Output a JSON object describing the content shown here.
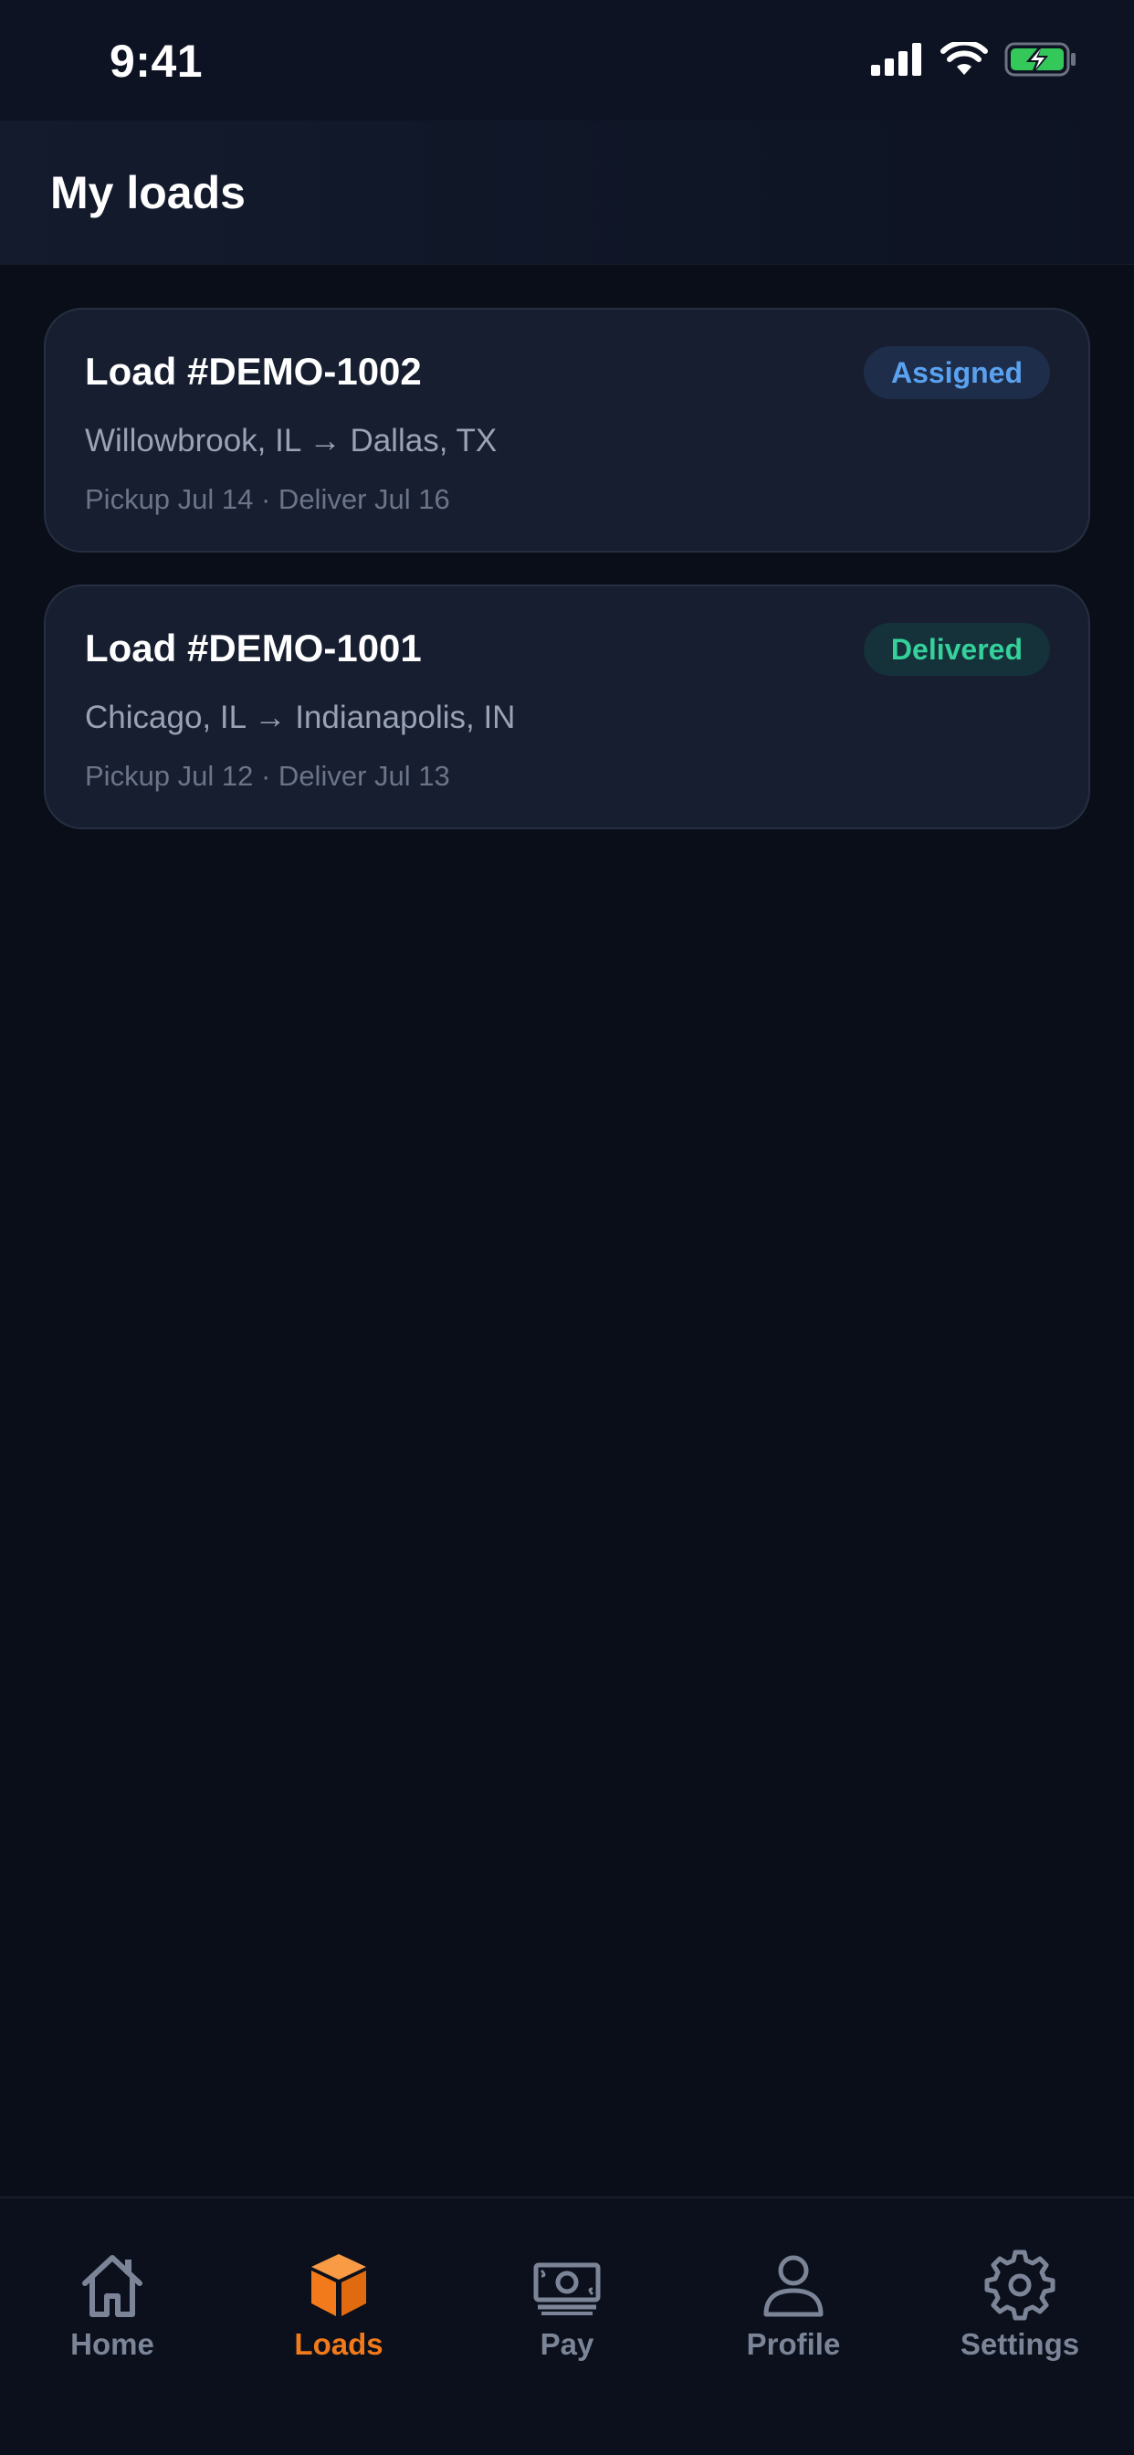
{
  "status_bar": {
    "time": "9:41"
  },
  "header": {
    "title": "My loads"
  },
  "loads": [
    {
      "title": "Load #DEMO-1002",
      "route": "Willowbrook, IL → Dallas, TX",
      "dates": "Pickup Jul 14 · Deliver Jul 16",
      "status": "Assigned"
    },
    {
      "title": "Load #DEMO-1001",
      "route": "Chicago, IL → Indianapolis, IN",
      "dates": "Pickup Jul 12 · Deliver Jul 13",
      "status": "Delivered"
    }
  ],
  "tabs": [
    {
      "label": "Home",
      "icon": "home-icon",
      "active": false
    },
    {
      "label": "Loads",
      "icon": "box-icon",
      "active": true
    },
    {
      "label": "Pay",
      "icon": "cash-icon",
      "active": false
    },
    {
      "label": "Profile",
      "icon": "person-icon",
      "active": false
    },
    {
      "label": "Settings",
      "icon": "gear-icon",
      "active": false
    }
  ],
  "colors": {
    "background": "#0a0e18",
    "card": "#161e30",
    "accent": "#f27a1a",
    "assigned": "#5aa2f0",
    "delivered": "#34d19a",
    "tab_inactive": "#7c8597"
  }
}
